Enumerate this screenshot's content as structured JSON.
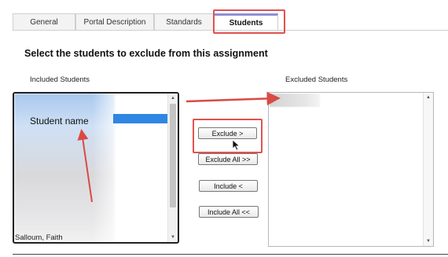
{
  "tabs": [
    {
      "label": "General"
    },
    {
      "label": "Portal Description"
    },
    {
      "label": "Standards"
    },
    {
      "label": "Students",
      "active": true
    }
  ],
  "heading": "Select the students to exclude from this assignment",
  "included": {
    "label": "Included Students",
    "annotation": "Student name",
    "visible_item": "Salloum, Faith"
  },
  "excluded": {
    "label": "Excluded Students"
  },
  "buttons": {
    "exclude": "Exclude >",
    "exclude_all": "Exclude All >>",
    "include": "Include <",
    "include_all": "Include All <<"
  },
  "colors": {
    "highlight": "#e0534f",
    "selection": "#2f86e3",
    "active_tab_accent": "#8e8fd3"
  }
}
